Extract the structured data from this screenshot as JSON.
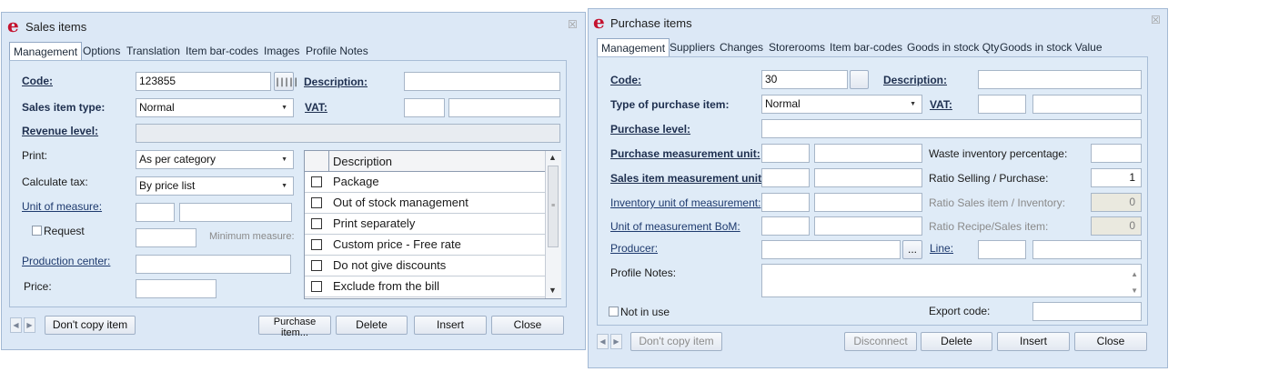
{
  "sales": {
    "title": "Sales items",
    "close": "☒",
    "tabs": [
      "Management",
      "Options",
      "Translation",
      "Item bar-codes",
      "Images",
      "Profile Notes"
    ],
    "code_label": "Code:",
    "code_value": "123855",
    "barcode_icon": "barcode-icon",
    "description_label": "Description:",
    "description_value": "",
    "type_label": "Sales item type:",
    "type_value": "Normal",
    "vat_label": "VAT:",
    "revenue_label": "Revenue level:",
    "print_label": "Print:",
    "print_value": "As per category",
    "calc_tax_label": "Calculate tax:",
    "calc_tax_value": "By price list",
    "uom_label": "Unit of measure:",
    "request_label": "Request",
    "min_measure_label": "Minimum measure:",
    "prod_center_label": "Production center:",
    "price_label": "Price:",
    "grid_header": "Description",
    "grid_rows": [
      "Package",
      "Out of stock management",
      "Print separately",
      "Custom price - Free rate",
      "Do not give discounts",
      "Exclude from the bill"
    ],
    "buttons": {
      "dont_copy": "Don't copy item",
      "purchase_line1": "Purchase",
      "purchase_line2": "item...",
      "delete": "Delete",
      "insert": "Insert",
      "close": "Close"
    }
  },
  "purchase": {
    "title": "Purchase items",
    "close": "☒",
    "tabs": [
      "Management",
      "Suppliers",
      "Changes",
      "Storerooms",
      "Item bar-codes",
      "Goods in stock Qty",
      "Goods in stock Value"
    ],
    "code_label": "Code:",
    "code_value": "30",
    "description_label": "Description:",
    "type_label": "Type of purchase item:",
    "type_value": "Normal",
    "vat_label": "VAT:",
    "purchase_level_label": "Purchase level:",
    "pmu_label": "Purchase measurement unit:",
    "waste_label": "Waste inventory percentage:",
    "simu_label": "Sales item measurement unit:",
    "ratio_sp_label": "Ratio Selling / Purchase:",
    "ratio_sp_value": "1",
    "inv_unit_label": "Inventory unit of measurement:",
    "ratio_si_label": "Ratio Sales item / Inventory:",
    "ratio_si_value": "0",
    "bom_label": "Unit of measurement BoM:",
    "ratio_rs_label": "Ratio Recipe/Sales item:",
    "ratio_rs_value": "0",
    "producer_label": "Producer:",
    "producer_btn": "...",
    "line_label": "Line:",
    "profile_notes_label": "Profile Notes:",
    "not_in_use_label": "Not in use",
    "export_code_label": "Export code:",
    "buttons": {
      "dont_copy": "Don't copy item",
      "disconnect": "Disconnect",
      "delete": "Delete",
      "insert": "Insert",
      "close": "Close"
    }
  }
}
